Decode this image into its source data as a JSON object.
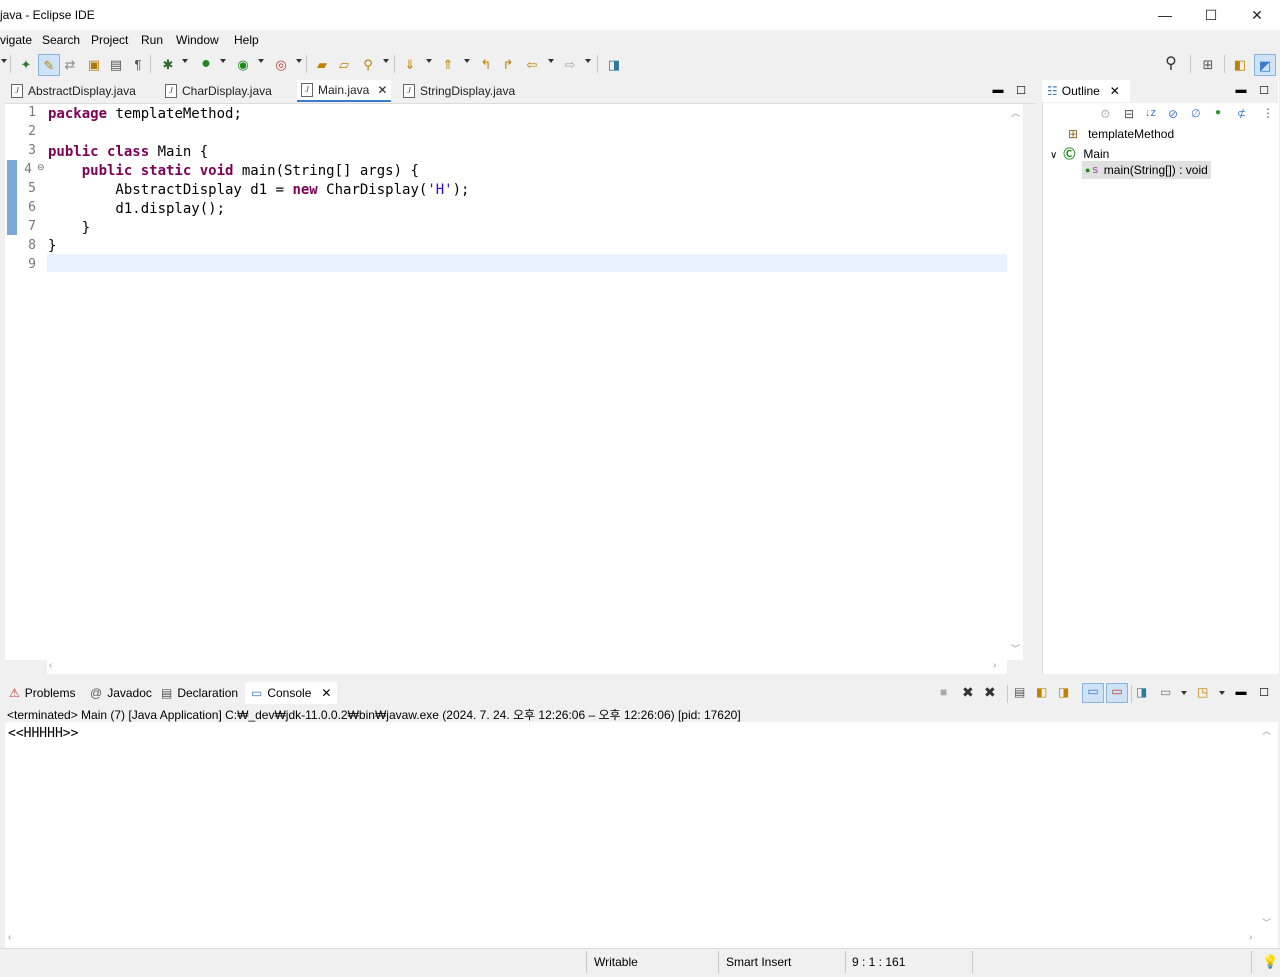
{
  "window": {
    "title": "java - Eclipse IDE",
    "minimize": "—",
    "maximize": "☐",
    "close": "✕"
  },
  "menu": {
    "items": [
      "vigate",
      "Search",
      "Project",
      "Run",
      "Window",
      "Help"
    ]
  },
  "editor": {
    "tabs": [
      {
        "label": "AbstractDisplay.java"
      },
      {
        "label": "CharDisplay.java"
      },
      {
        "label": "Main.java"
      },
      {
        "label": "StringDisplay.java"
      }
    ],
    "line_numbers": [
      "1",
      "2",
      "3",
      "4",
      "5",
      "6",
      "7",
      "8",
      "9"
    ],
    "code": {
      "l1_kw": "package",
      "l1_rest": " templateMethod;",
      "l3_kw": "public class",
      "l3_rest": " Main {",
      "l4_indent": "    ",
      "l4_kw": "public static void",
      "l4_rest": " main(String[] args) {",
      "l5_a": "        AbstractDisplay d1 = ",
      "l5_kw": "new",
      "l5_b": " CharDisplay(",
      "l5_str": "'H'",
      "l5_c": ");",
      "l6": "        d1.display();",
      "l7": "    }",
      "l8": "}"
    },
    "fold_marker": "⊖",
    "current_line": 9
  },
  "outline": {
    "tab_label": "Outline",
    "items": {
      "package": "templateMethod",
      "class": "Main",
      "method": "main(String[]) : void",
      "method_modifier": "S"
    }
  },
  "console": {
    "tabs": [
      {
        "label": "Problems"
      },
      {
        "label": "Javadoc"
      },
      {
        "label": "Declaration"
      },
      {
        "label": "Console"
      }
    ],
    "status": "<terminated> Main (7) [Java Application] C:₩_dev₩jdk-11.0.0.2₩bin₩javaw.exe  (2024. 7. 24. 오후 12:26:06 – 오후 12:26:06) [pid: 17620]",
    "output": "<<HHHHH>>"
  },
  "statusbar": {
    "writable": "Writable",
    "insert_mode": "Smart Insert",
    "position": "9 : 1 : 161"
  },
  "colors": {
    "keyword": "#7f0055",
    "string": "#2a00ff",
    "active_tab_border": "#3c7bc8",
    "current_line_bg": "#e8f2fe"
  }
}
